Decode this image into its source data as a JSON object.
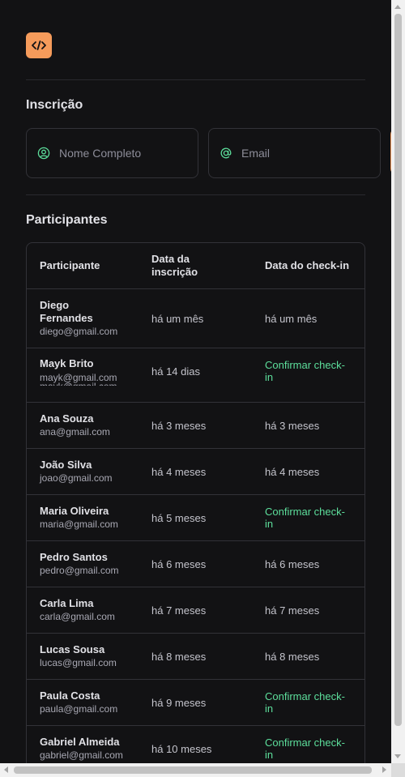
{
  "header": {
    "logo_icon": "code-icon"
  },
  "registration": {
    "title": "Inscrição",
    "name_placeholder": "Nome Completo",
    "email_placeholder": "Email"
  },
  "participants": {
    "title": "Participantes",
    "columns": {
      "participant": "Participante",
      "registration_date_line1": "Data da",
      "registration_date_line2": "inscrição",
      "checkin_date": "Data do check-in"
    },
    "rows": [
      {
        "name_line1": "Diego",
        "name_line2": "Fernandes",
        "email": "diego@gmail.com",
        "registered": "há um mês",
        "checkin": "há um mês",
        "confirm": false
      },
      {
        "name_line1": "Mayk Brito",
        "name_line2": "",
        "email": "mayk@gmail.com",
        "registered": "há 14 dias",
        "checkin_line1": "Confirmar check-",
        "checkin_line2": "in",
        "confirm": true
      },
      {
        "name_line1": "Ana Souza",
        "name_line2": "",
        "email": "ana@gmail.com",
        "registered": "há 3 meses",
        "checkin": "há 3 meses",
        "confirm": false
      },
      {
        "name_line1": "João Silva",
        "name_line2": "",
        "email": "joao@gmail.com",
        "registered": "há 4 meses",
        "checkin": "há 4 meses",
        "confirm": false
      },
      {
        "name_line1": "Maria Oliveira",
        "name_line2": "",
        "email": "maria@gmail.com",
        "registered": "há 5 meses",
        "checkin_line1": "Confirmar check-",
        "checkin_line2": "in",
        "confirm": true
      },
      {
        "name_line1": "Pedro Santos",
        "name_line2": "",
        "email": "pedro@gmail.com",
        "registered": "há 6 meses",
        "checkin": "há 6 meses",
        "confirm": false
      },
      {
        "name_line1": "Carla Lima",
        "name_line2": "",
        "email": "carla@gmail.com",
        "registered": "há 7 meses",
        "checkin": "há 7 meses",
        "confirm": false
      },
      {
        "name_line1": "Lucas Sousa",
        "name_line2": "",
        "email": "lucas@gmail.com",
        "registered": "há 8 meses",
        "checkin": "há 8 meses",
        "confirm": false
      },
      {
        "name_line1": "Paula Costa",
        "name_line2": "",
        "email": "paula@gmail.com",
        "registered": "há 9 meses",
        "checkin_line1": "Confirmar check-",
        "checkin_line2": "in",
        "confirm": true
      },
      {
        "name_line1": "Gabriel Almeida",
        "name_line2": "",
        "email": "gabriel@gmail.com",
        "registered": "há 10 meses",
        "checkin_line1": "Confirmar check-",
        "checkin_line2": "in",
        "confirm": true
      }
    ]
  },
  "colors": {
    "background": "#121214",
    "accent": "#f59b5b",
    "confirm": "#5ddf9c",
    "border": "#323238"
  }
}
